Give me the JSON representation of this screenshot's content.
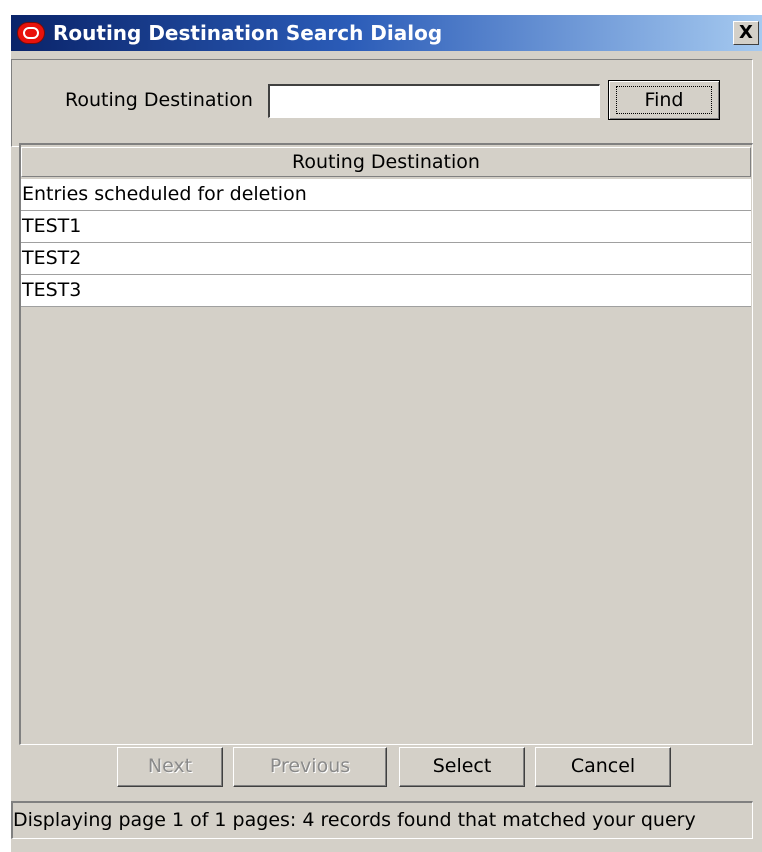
{
  "window": {
    "title": "Routing Destination Search Dialog",
    "close_label": "X"
  },
  "search": {
    "label": "Routing Destination",
    "value": "",
    "find_label": "Find"
  },
  "table": {
    "column_header": "Routing Destination",
    "rows": [
      "Entries scheduled for deletion",
      "TEST1",
      "TEST2",
      "TEST3"
    ]
  },
  "buttons": {
    "next": "Next",
    "previous": "Previous",
    "select": "Select",
    "cancel": "Cancel"
  },
  "status": {
    "text": "Displaying page 1 of 1 pages:   4 records found that matched your query"
  }
}
